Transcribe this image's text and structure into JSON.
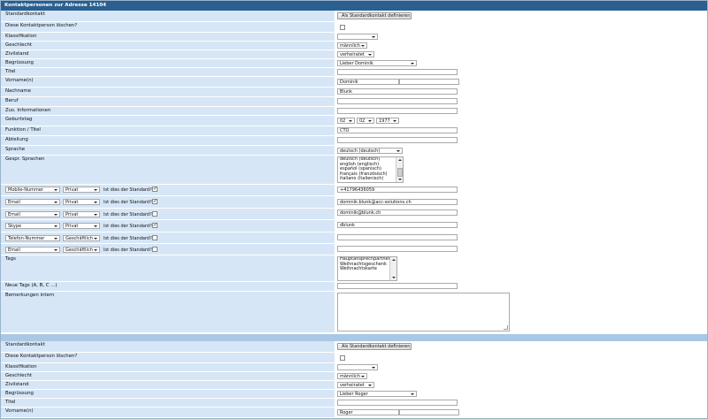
{
  "header": {
    "title": "Kontaktpersonen zur Adresse 14104"
  },
  "labels": {
    "standardkontakt": "Standardkontakt",
    "loeschen": "Diese Kontaktperson löschen?",
    "klassifikation": "Klassifikation",
    "geschlecht": "Geschlecht",
    "zivilstand": "Zivilstand",
    "begruessung": "Begrüssung",
    "titel": "Titel",
    "vorname": "Vorname(n)",
    "nachname": "Nachname",
    "beruf": "Beruf",
    "zus_info": "Zus. Informationen",
    "geburtstag": "Geburtstag",
    "funktion": "Funktion / Titel",
    "abteilung": "Abteilung",
    "sprache": "Sprache",
    "gespr_sprachen": "Gespr. Sprachen",
    "tags": "Tags",
    "neue_tags": "Neue Tags (A, B, C ...)",
    "bemerkungen": "Bemerkungen intern",
    "ist_standard": "Ist dies der Standard?"
  },
  "buttons": {
    "als_standard": "Als Standardkontakt definieren"
  },
  "contact1": {
    "geschlecht": "männlich",
    "zivilstand": "verheiratet",
    "begruessung": "Lieber Dominik",
    "titel": "",
    "vorname": "Dominik",
    "nachname": "Blunk",
    "beruf": "",
    "zus_info": "",
    "geburtstag": {
      "day": "02",
      "month": "02",
      "year": "1977"
    },
    "funktion": "CTO",
    "abteilung": "",
    "sprache": "deutsch (deutsch)",
    "gespr_sprachen": [
      "deutsch (deutsch)",
      "english (englisch)",
      "español (spanisch)",
      "français (französisch)",
      "italiano (italienisch)"
    ],
    "channels": [
      {
        "type": "Mobile-Nummer",
        "scope": "Privat",
        "checked": true,
        "value": "+41796436059"
      },
      {
        "type": "Email",
        "scope": "Privat",
        "checked": true,
        "value": "dominik.blunk@acc-solutions.ch"
      },
      {
        "type": "Email",
        "scope": "Privat",
        "checked": false,
        "value": "dominik@blunk.ch"
      },
      {
        "type": "Skype",
        "scope": "Privat",
        "checked": true,
        "value": "dblunk"
      },
      {
        "type": "Telefon-Nummer",
        "scope": "Geschäftlich",
        "checked": false,
        "value": ""
      },
      {
        "type": "Email",
        "scope": "Geschäftlich",
        "checked": false,
        "value": ""
      }
    ],
    "tags": [
      "Hauptansprechpartner",
      "Weihnachtsgeschenk",
      "Weihnachtskarte"
    ],
    "neue_tags": "",
    "bemerkungen": ""
  },
  "contact2": {
    "geschlecht": "männlich",
    "zivilstand": "verheiratet",
    "begruessung": "Lieber Roger",
    "titel": "",
    "vorname": "Roger"
  }
}
